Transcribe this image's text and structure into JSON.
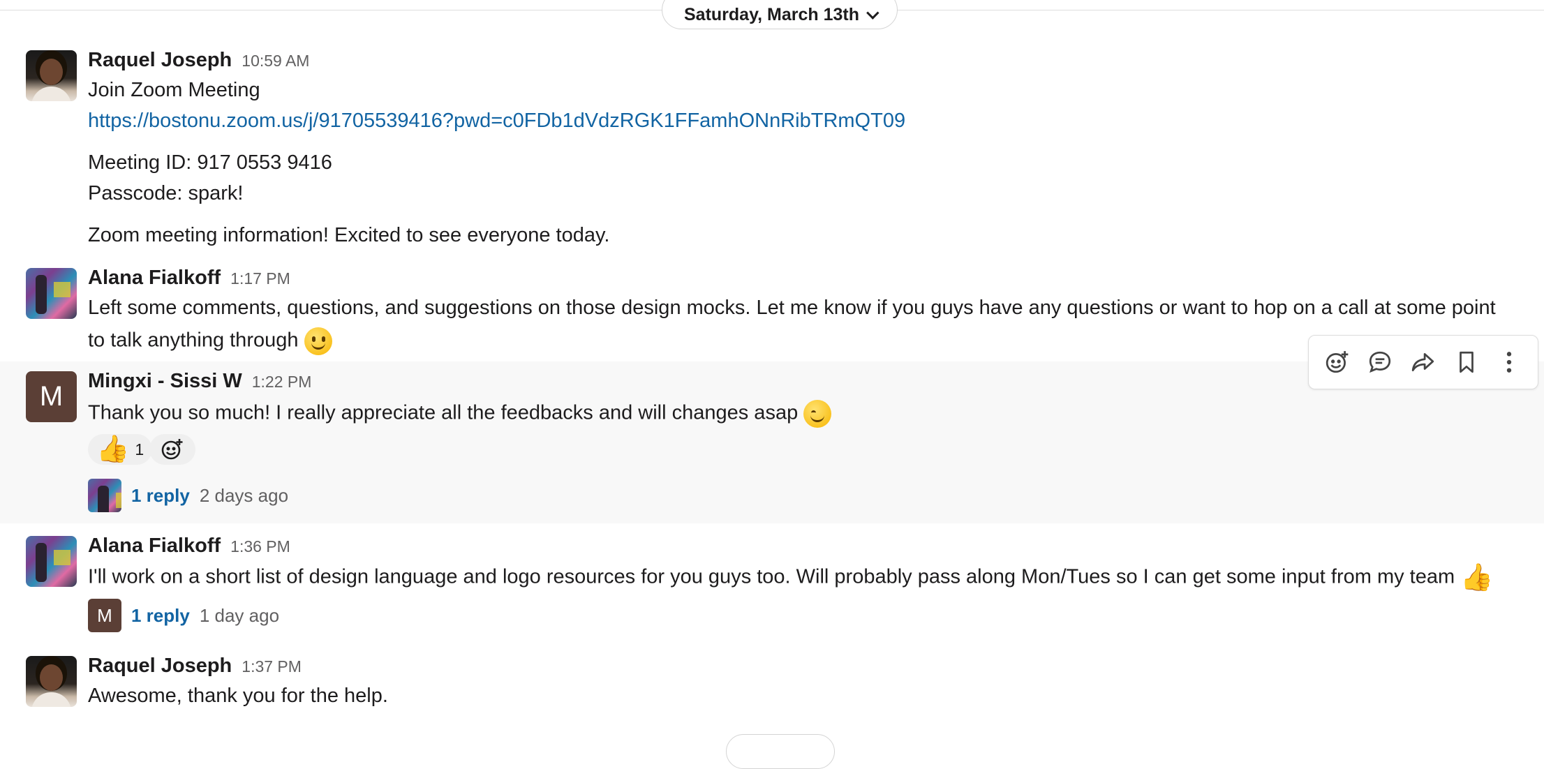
{
  "date_divider": {
    "label": "Saturday, March 13th"
  },
  "messages": [
    {
      "author": "Raquel Joseph",
      "time": "10:59 AM",
      "lines": [
        "Join Zoom Meeting",
        "https://bostonu.zoom.us/j/91705539416?pwd=c0FDb1dVdzRGK1FFamhONnRibTRmQT09",
        "Meeting ID: 917 0553 9416",
        "Passcode: spark!",
        "Zoom meeting information! Excited to see everyone today."
      ]
    },
    {
      "author": "Alana Fialkoff",
      "time": "1:17 PM",
      "lines": [
        "Left some comments, questions, and suggestions on those design mocks. Let me know if you guys have any questions or want to hop on a call at some point",
        "to talk anything through"
      ],
      "emoji": "slightly-smiling-face"
    },
    {
      "author": "Mingxi - Sissi W",
      "avatar_letter": "M",
      "time": "1:22 PM",
      "lines": [
        "Thank you so much! I really appreciate all the feedbacks and will changes asap"
      ],
      "emoji": "blush",
      "reactions": [
        {
          "emoji": "thumbsup",
          "count": "1"
        }
      ],
      "thread": {
        "reply": "1 reply",
        "ago": "2 days ago"
      }
    },
    {
      "author": "Alana Fialkoff",
      "time": "1:36 PM",
      "lines": [
        "I'll work on a short list of design language and logo resources for you guys too. Will probably pass along Mon/Tues so I can get some input from my team"
      ],
      "emoji": "thumbsup",
      "thread": {
        "reply": "1 reply",
        "ago": "1 day ago",
        "avatar_letter": "M"
      }
    },
    {
      "author": "Raquel Joseph",
      "time": "1:37 PM",
      "lines": [
        "Awesome, thank you for the help."
      ]
    }
  ],
  "hover_toolbar": {
    "icons": [
      "add-reaction-icon",
      "reply-in-thread-icon",
      "share-icon",
      "bookmark-icon",
      "more-actions-icon"
    ]
  },
  "colors": {
    "link": "#1264a3",
    "hover_bg": "#f8f8f8",
    "m_avatar": "#5b3f36"
  }
}
